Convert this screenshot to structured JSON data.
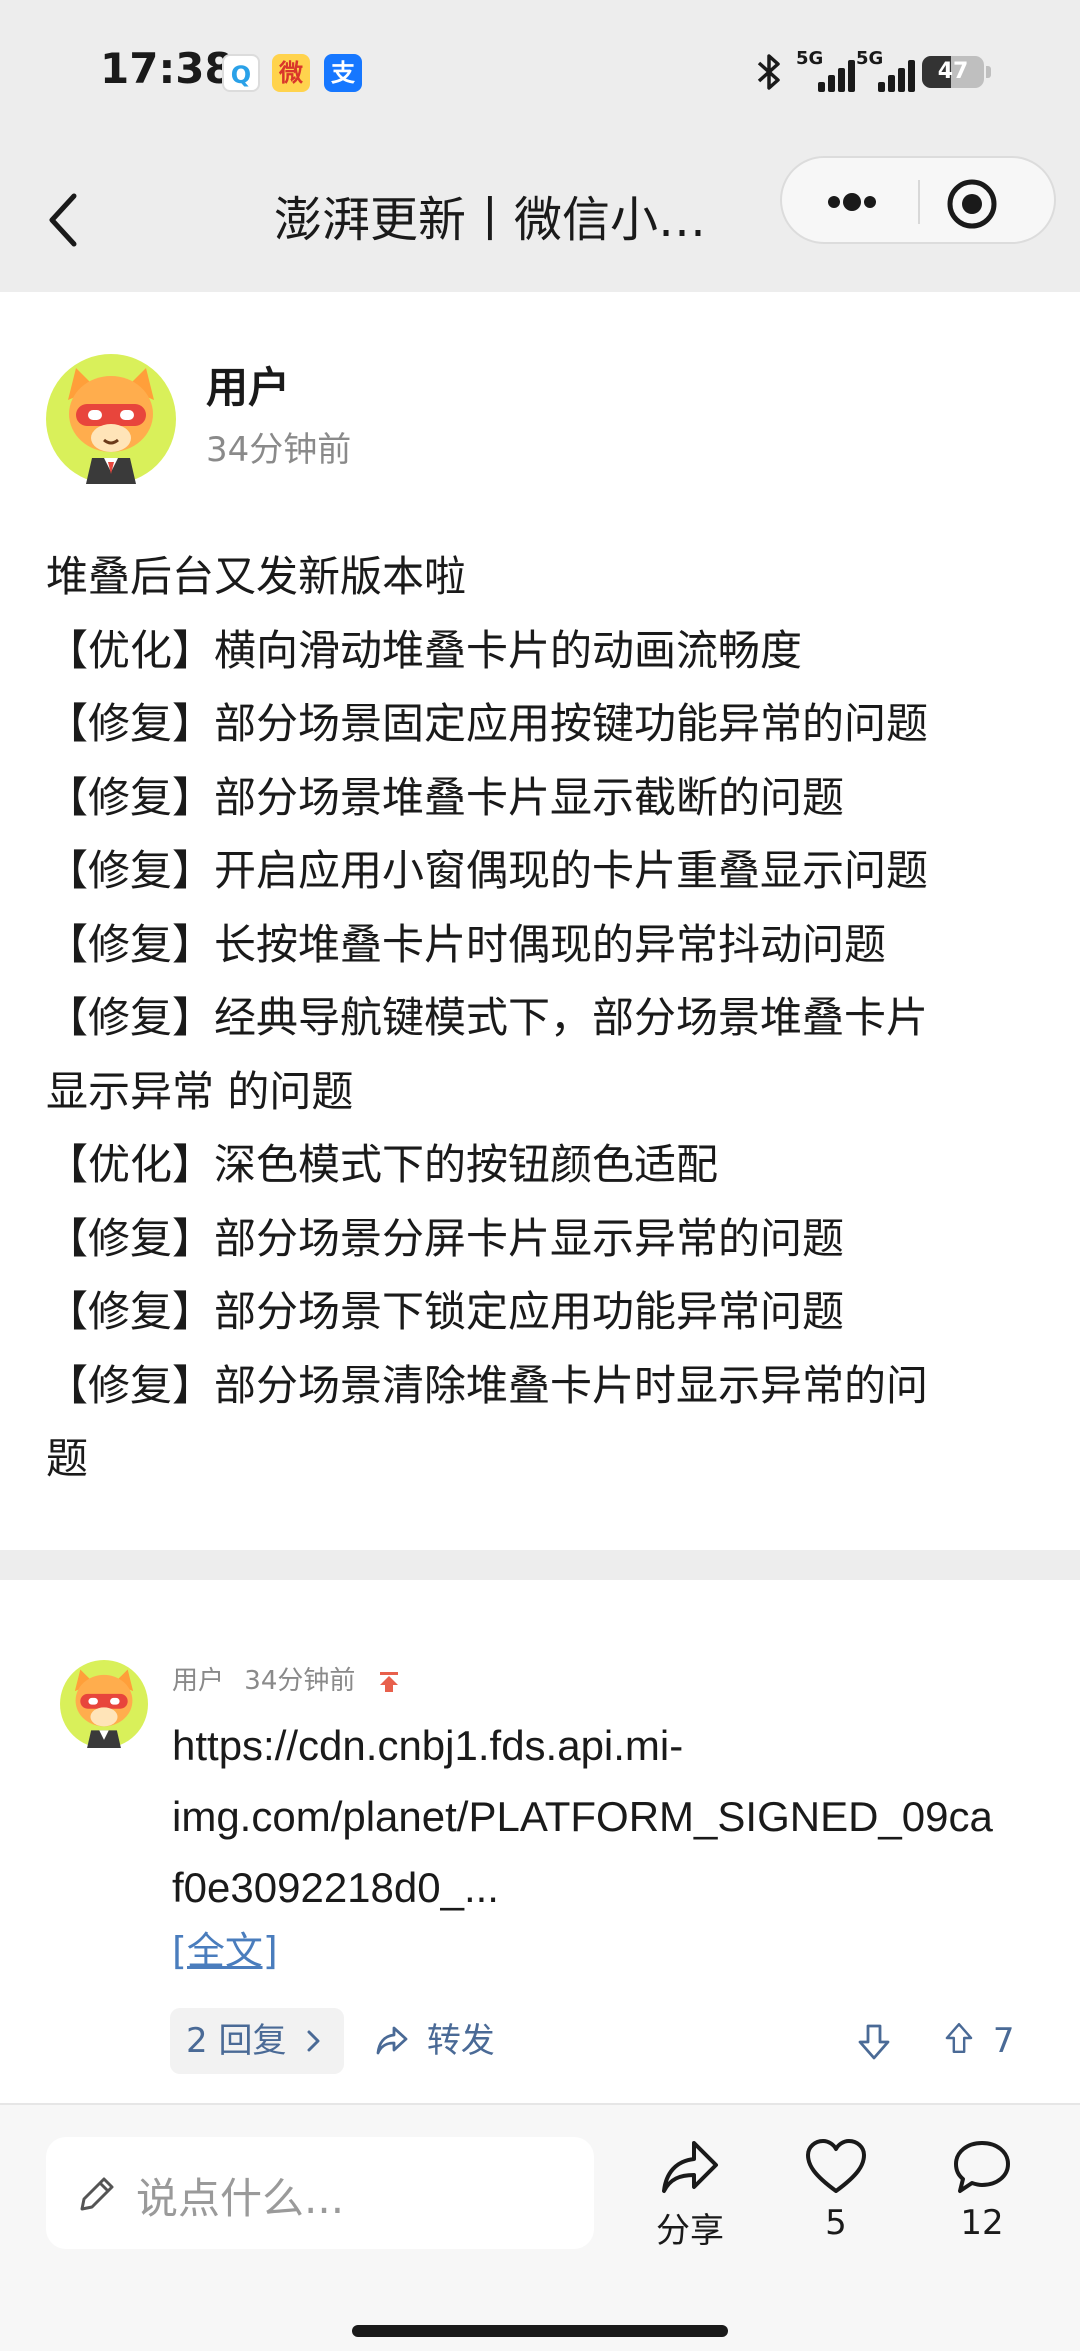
{
  "status_bar": {
    "time": "17:38",
    "app_icons": [
      "qq-browser-icon",
      "weibo-icon",
      "alipay-icon"
    ],
    "app_icon_glyphs": [
      "Q",
      "微",
      "支"
    ],
    "network_1": "5G",
    "network_2": "5G",
    "battery": "47",
    "battery_level": 0.47
  },
  "nav": {
    "title": "澎湃更新丨微信小…"
  },
  "post": {
    "author": "用户",
    "time": "34分钟前",
    "lines": [
      "堆叠后台又发新版本啦",
      "【优化】横向滑动堆叠卡片的动画流畅度",
      "【修复】部分场景固定应用按键功能异常的问题",
      "【修复】部分场景堆叠卡片显示截断的问题",
      "【修复】开启应用小窗偶现的卡片重叠显示问题",
      "【修复】长按堆叠卡片时偶现的异常抖动问题",
      "【修复】经典导航键模式下，部分场景堆叠卡片",
      "显示异常 的问题",
      "【优化】深色模式下的按钮颜色适配",
      "【修复】部分场景分屏卡片显示异常的问题",
      "【修复】部分场景下锁定应用功能异常问题",
      "【修复】部分场景清除堆叠卡片时显示异常的问",
      "题"
    ]
  },
  "comment": {
    "author": "用户",
    "time": "34分钟前",
    "text": "https://cdn.cnbj1.fds.api.mi-\nimg.com/planet/PLATFORM_SIGNED_09ca\nf0e3092218d0_...",
    "full_text_link": "[全文]",
    "replies_label": "2 回复",
    "forward_label": "转发",
    "upvotes": "7"
  },
  "bottom_bar": {
    "input_placeholder": "说点什么...",
    "share_label": "分享",
    "likes": "5",
    "comments": "12"
  },
  "colors": {
    "header_bg": "#ededed",
    "link": "#4a7dbd",
    "action_text": "#4a6a96",
    "pin_red": "#e8604c",
    "avatar_bg": "#d9f05a"
  }
}
